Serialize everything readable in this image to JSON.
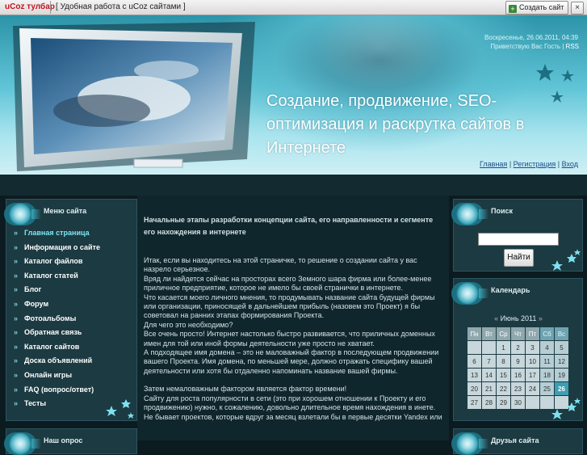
{
  "toolbar": {
    "brand": "uCoz тулбар",
    "slogan": "Удобная работа с uCoz сайтами",
    "create_site": "Создать сайт",
    "close": "×"
  },
  "header": {
    "datetime": "Воскресенье, 26.06.2011, 04:39",
    "greeting_prefix": "Приветствую Вас Гость | ",
    "rss": "RSS",
    "site_title": "Создание, продвижение, SEO-оптимизация и раскрутка сайтов в Интернете",
    "links": {
      "home": "Главная",
      "register": "Регистрация",
      "login": "Вход",
      "sep": " | "
    }
  },
  "sidebar_left": {
    "title": "Меню сайта",
    "items": [
      "Главная страница",
      "Информация о сайте",
      "Каталог файлов",
      "Каталог статей",
      "Блог",
      "Форум",
      "Фотоальбомы",
      "Обратная связь",
      "Каталог сайтов",
      "Доска объявлений",
      "Онлайн игры",
      "FAQ (вопрос/ответ)",
      "Тесты"
    ],
    "next_title": "Наш опрос"
  },
  "article": {
    "title": "Начальные этапы разработки концепции сайта, его направленности и сегменте его нахождения в интернете",
    "paragraphs": [
      "Итак, если вы находитесь на этой страничке, то решение о создании сайта у вас назрело серьезное.",
      "Вряд ли найдется сейчас на просторах всего Земного шара фирма или более-менее приличное предприятие, которое не имело бы своей странички в интернете.",
      "Что касается моего личного мнения, то продумывать название сайта будущей фирмы или организации, приносящей в дальнейшем прибыль (назовем это Проект) я бы советовал на ранних этапах формирования Проекта.",
      "Для чего это необходимо?",
      "Все очень просто! Интернет настолько быстро развивается, что приличных доменных имен для той или иной формы деятельности уже просто не хватает.",
      "А подходящее имя домена – это не маловажный фактор в последующем продвижении вашего Проекта. Имя домена, по меньшей мере, должно отражать специфику вашей деятельности или хотя бы отдаленно напоминать название вашей фирмы.",
      "",
      "Затем немаловажным фактором является фактор времени!",
      "Сайту для роста популярности в сети (это при хорошем отношении к Проекту и его продвижению) нужно, к сожалению, довольно длительное время нахождения в инете.",
      "Не бывает проектов, которые вдруг за месяц взлетали бы в первые десятки Yandex или"
    ]
  },
  "search": {
    "title": "Поиск",
    "input_value": "",
    "button": "Найти"
  },
  "calendar": {
    "title": "Календарь",
    "prev": "«",
    "month": "Июнь 2011",
    "next": "»",
    "weekdays": [
      "Пн",
      "Вт",
      "Ср",
      "Чт",
      "Пт",
      "Сб",
      "Вс"
    ],
    "weeks": [
      [
        "",
        "",
        "1",
        "2",
        "3",
        "4",
        "5"
      ],
      [
        "6",
        "7",
        "8",
        "9",
        "10",
        "11",
        "12"
      ],
      [
        "13",
        "14",
        "15",
        "16",
        "17",
        "18",
        "19"
      ],
      [
        "20",
        "21",
        "22",
        "23",
        "24",
        "25",
        "26"
      ],
      [
        "27",
        "28",
        "29",
        "30",
        "",
        "",
        ""
      ]
    ],
    "today": "26"
  },
  "sidebar_right_next_title": "Друзья сайта",
  "colors": {
    "accent": "#3c9fb3",
    "active_menu": "#7ee6f2",
    "panel_bg": "#1c3a42"
  }
}
